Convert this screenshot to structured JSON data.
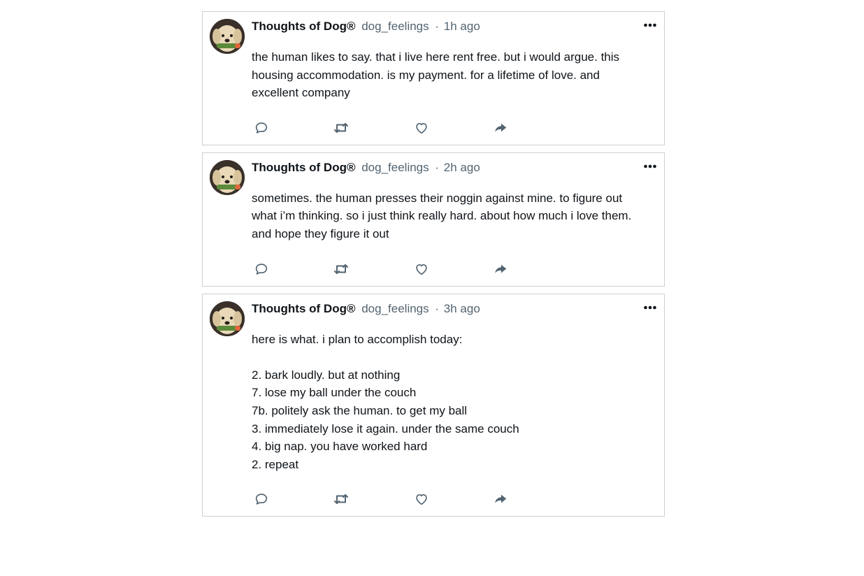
{
  "tweets": [
    {
      "author_name": "Thoughts of Dog®",
      "handle": "dog_feelings",
      "separator": "·",
      "time": "1h ago",
      "text": "the human likes to say. that i live here rent free. but i would argue. this housing accommodation. is my payment. for a lifetime of love. and excellent company"
    },
    {
      "author_name": "Thoughts of Dog®",
      "handle": "dog_feelings",
      "separator": "·",
      "time": "2h ago",
      "text": "sometimes. the human presses their noggin against mine. to figure out what i’m thinking. so i just think really hard. about how much i love them. and hope they figure it out"
    },
    {
      "author_name": "Thoughts of Dog®",
      "handle": "dog_feelings",
      "separator": "·",
      "time": "3h ago",
      "text": "here is what. i plan to accomplish today:\n\n2. bark loudly. but at nothing\n7. lose my ball under the couch\n7b. politely ask the human. to get my ball\n3. immediately lose it again. under the same couch\n4. big nap. you have worked hard\n2. repeat"
    }
  ],
  "icons": {
    "avatar": "dog-avatar-icon",
    "more": "more-horizontal-icon",
    "reply": "reply-icon",
    "retweet": "retweet-icon",
    "like": "heart-icon",
    "share": "share-icon"
  },
  "colors": {
    "text": "#0f1419",
    "secondary": "#536471",
    "border": "#cfcfcf",
    "icon": "#536471"
  }
}
